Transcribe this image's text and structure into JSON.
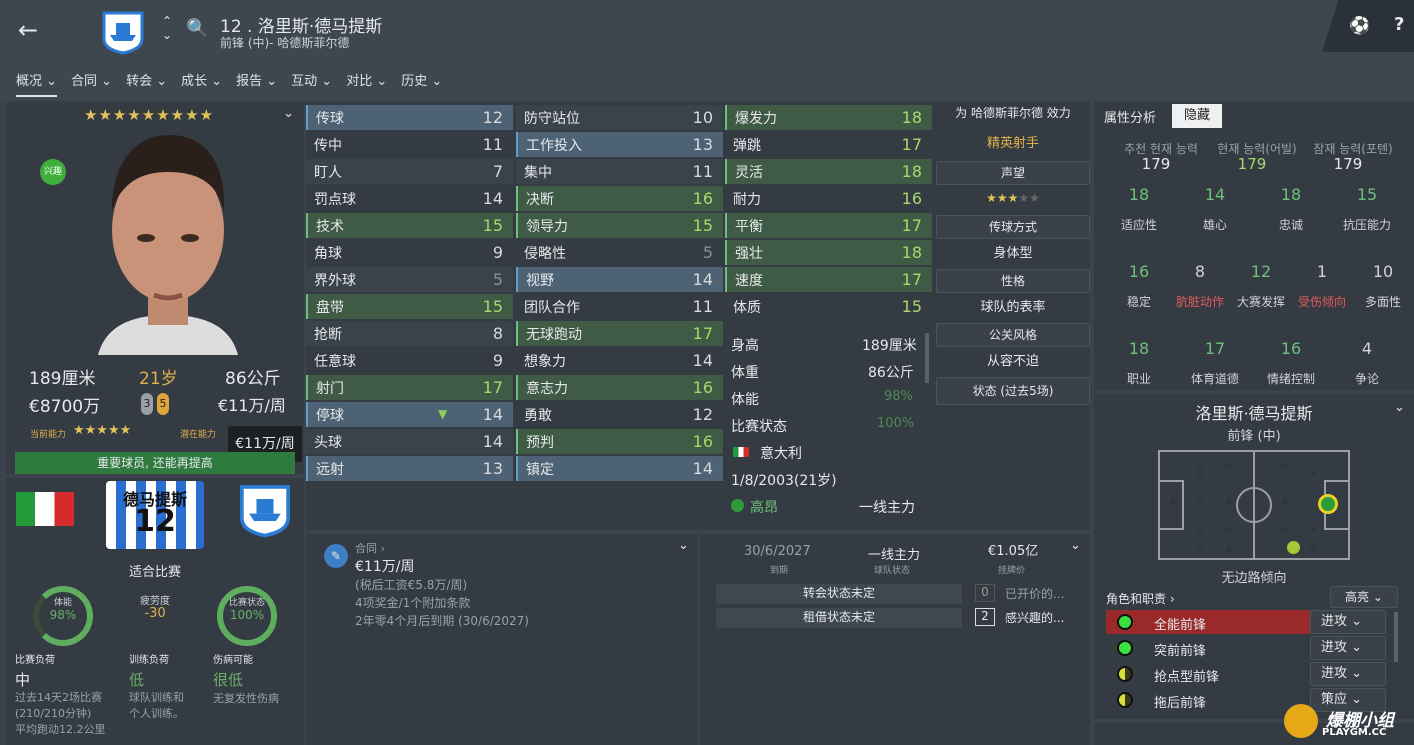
{
  "header": {
    "title": "12 . 洛里斯·德马提斯",
    "subtitle": "前锋 (中)- 哈德斯菲尔德"
  },
  "tabs": [
    "概况 ⌄",
    "合同 ⌄",
    "转会 ⌄",
    "成长 ⌄",
    "报告 ⌄",
    "互动 ⌄",
    "对比 ⌄",
    "历史 ⌄"
  ],
  "profile": {
    "stars": "★★★★★★★★★",
    "badge": "兴趣",
    "height": "189厘米",
    "age": "21岁",
    "weight": "86公斤",
    "value": "€8700万",
    "wage": "€11万/周",
    "foot_l": "3",
    "foot_r": "5",
    "cur_label": "当前能力",
    "pot_label": "潜在能力",
    "cur_stars": "★★★★★",
    "tooltip": "€11万/周",
    "banner": "重要球员, 还能再提高"
  },
  "cond": {
    "shirt_name": "德马提斯",
    "shirt_no": "12",
    "suitable": "适合比赛",
    "fitness": "体能",
    "fitness_pct": "98%",
    "fatigue": "疲劳度",
    "fatigue_val": "-30",
    "match_form": "比赛状态",
    "match_pct": "100%",
    "load_h": "比赛负荷",
    "load_v": "中",
    "load_t": "过去14天2场比赛\n(210/210分钟)\n平均跑动12.2公里",
    "train_h": "训练负荷",
    "train_v": "低",
    "train_t": "球队训练和\n个人训练。",
    "inj_h": "伤病可能",
    "inj_v": "很低",
    "inj_t": "无复发性伤病"
  },
  "attrs": {
    "tech": [
      [
        "传球",
        "12"
      ],
      [
        "传中",
        "11"
      ],
      [
        "盯人",
        "7"
      ],
      [
        "罚点球",
        "14"
      ],
      [
        "技术",
        "15"
      ],
      [
        "角球",
        "9"
      ],
      [
        "界外球",
        "5"
      ],
      [
        "盘带",
        "15"
      ],
      [
        "抢断",
        "8"
      ],
      [
        "任意球",
        "9"
      ],
      [
        "射门",
        "17"
      ],
      [
        "停球",
        "14"
      ],
      [
        "头球",
        "14"
      ],
      [
        "远射",
        "13"
      ]
    ],
    "ment": [
      [
        "防守站位",
        "10"
      ],
      [
        "工作投入",
        "13"
      ],
      [
        "集中",
        "11"
      ],
      [
        "决断",
        "16"
      ],
      [
        "领导力",
        "15"
      ],
      [
        "侵略性",
        "5"
      ],
      [
        "视野",
        "14"
      ],
      [
        "团队合作",
        "11"
      ],
      [
        "无球跑动",
        "17"
      ],
      [
        "想象力",
        "14"
      ],
      [
        "意志力",
        "16"
      ],
      [
        "勇敢",
        "12"
      ],
      [
        "预判",
        "16"
      ],
      [
        "镇定",
        "14"
      ]
    ],
    "phys": [
      [
        "爆发力",
        "18"
      ],
      [
        "弹跳",
        "17"
      ],
      [
        "灵活",
        "18"
      ],
      [
        "耐力",
        "16"
      ],
      [
        "平衡",
        "17"
      ],
      [
        "强壮",
        "18"
      ],
      [
        "速度",
        "17"
      ],
      [
        "体质",
        "15"
      ]
    ]
  },
  "info": {
    "h_label": "身高",
    "h_val": "189厘米",
    "w_label": "体重",
    "w_val": "86公斤",
    "fit_label": "体能",
    "fit_val": "98%",
    "mf_label": "比赛状态",
    "mf_val": "100%",
    "nation": "意大利",
    "dob": "1/8/2003(21岁)",
    "morale": "高昂",
    "status": "一线主力"
  },
  "side": {
    "club_line": "为 哈德斯菲尔德 效力",
    "role": "精英射手",
    "rep": "声望",
    "rep_stars": "★★★",
    "rep_empty": "★★",
    "pass_h": "传球方式",
    "pass_v": "身体型",
    "pers_h": "性格",
    "pers_v": "球队的表率",
    "media_h": "公关风格",
    "media_v": "从容不迫",
    "form_h": "状态 (过去5场)"
  },
  "analysis": {
    "tab1": "属性分析",
    "tab2": "隐藏",
    "abil": [
      [
        "추천 현재 능력",
        "179"
      ],
      [
        "현재 능력(어빌)",
        "179"
      ],
      [
        "잠재 능력(포텐)",
        "179"
      ]
    ],
    "grid": [
      [
        "18",
        "适应性"
      ],
      [
        "14",
        "雄心"
      ],
      [
        "18",
        "忠诚"
      ],
      [
        "15",
        "抗压能力"
      ],
      [
        "16",
        "稳定"
      ],
      [
        "8",
        "肮脏动作"
      ],
      [
        "12",
        "大赛发挥"
      ],
      [
        "1",
        "受伤倾向"
      ],
      [
        "10",
        "多面性"
      ],
      [
        "18",
        "职业"
      ],
      [
        "17",
        "体育道德"
      ],
      [
        "16",
        "情绪控制"
      ],
      [
        "4",
        "争论"
      ]
    ]
  },
  "pos": {
    "name": "洛里斯·德马提斯",
    "pos": "前锋 (中)",
    "foot": "无边路倾向",
    "roles_h": "角色和职责 ›",
    "hl": "高亮",
    "roles": [
      [
        "全能前锋",
        "进攻"
      ],
      [
        "突前前锋",
        "进攻"
      ],
      [
        "抢点型前锋",
        "进攻"
      ],
      [
        "拖后前锋",
        "策应"
      ]
    ]
  },
  "contract": {
    "h": "合同 ›",
    "wage": "€11万/周",
    "tax": "(税后工资€5.8万/周)",
    "bonus": "4项奖金/1个附加条款",
    "expire": "2年零4个月后到期 (30/6/2027)",
    "date": "30/6/2027",
    "date_l": "到期",
    "st": "一线主力",
    "st_l": "球队状态",
    "val": "€1.05亿",
    "val_l": "挂牌价",
    "t1": "转会状态未定",
    "t2": "租借状态未定",
    "n0": "0",
    "o0": "已开价的...",
    "n2": "2",
    "o2": "感兴趣的..."
  },
  "watermark": "爆棚小组",
  "watermark2": "PLAYGM.CC"
}
